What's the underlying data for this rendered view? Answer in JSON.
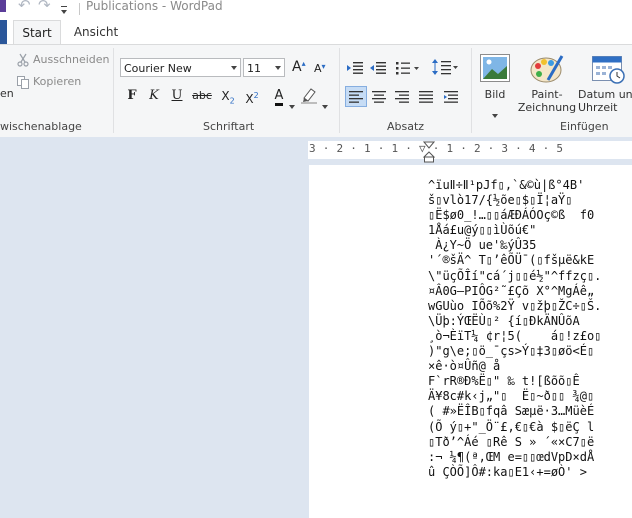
{
  "titlebar": {
    "title": "Publications - WordPad"
  },
  "tabs": {
    "home": "Start",
    "view": "Ansicht"
  },
  "clipboard": {
    "paste_partial": "en",
    "cut": "Ausschneiden",
    "copy": "Kopieren",
    "group": "wischenablage"
  },
  "font": {
    "family": "Courier New",
    "size": "11",
    "group": "Schriftart",
    "grow": "A",
    "shrink": "A",
    "bold": "F",
    "italic": "K",
    "underline": "U",
    "strike": "abc",
    "sub": "X",
    "sub_index": "2",
    "sup": "X",
    "sup_index": "2",
    "color_letter": "A"
  },
  "paragraph": {
    "group": "Absatz"
  },
  "insert": {
    "group": "Einfügen",
    "picture": "Bild",
    "paint_line1": "Paint-",
    "paint_line2": "Zeichnung",
    "date_line1": "Datum und",
    "date_line2": "Uhrzeit"
  },
  "ruler": {
    "text": "3 · 2 · 1 · 1 · ▽ · 1 · 2 · 3 · 4 · 5"
  },
  "document": {
    "lines": [
      "^ïuⅡ÷Ⅱ¹pJf▯,`&©ù|ß°4B'",
      "š▯vlò17/{½õe▯$▯Ï¦aŸ▯",
      "▯Ë$ø0_!…▯▯áÆÐÁÓOç©ß  f0",
      "1Åá£u@ý▯▯ìÙõú€\"",
      " À¿Y~Ö ue'‰ýÛ35",
      "'´®šÄ^ T▯’êÕÜ¯(▯fšµë&kE",
      "\\\"üçÕÎí\"cá´j▯▯é½\"^ffzç▯.",
      "¤Â0G—PIÔG²˜£Çõ X°^MgÁê„",
      "wGUùo IÕõ%2Ÿ v▯žþ▯ŽC÷▯Š.",
      "\\Üþ:ÝŒËÙ▯² {í▯ÐkÄNÛõA",
      "¸ò¬ÈïT¼ ¢r¦5(    á▯!z£o▯",
      ")\"g\\e;▯ö_¯çs>Ý▯‡3▯øö<É▯",
      "×ê·ò¤Ûñ@ å",
      "F`rR®Ð%Ë▯\" ‰ t![ßõõ▯Ê",
      "Ä¥8c#k‹j„\"▯  Ë▯~ð▯▯ ¾@▯",
      "( #»ËÎB▯fqâ Sæµë·3…MüèÉ",
      "(Õ ý▯+\"_Ö¨£,€▯€à $▯ëÇ l",
      "▯Tð’^Áé ▯Rê S » ´«×C7▯ë",
      ":¬ ¼¶(ª,ŒM e=▯▯œdVpD×dÅ",
      "û ÇÒÕ]Ô#:ka▯E1‹+=øÒ' >"
    ]
  }
}
